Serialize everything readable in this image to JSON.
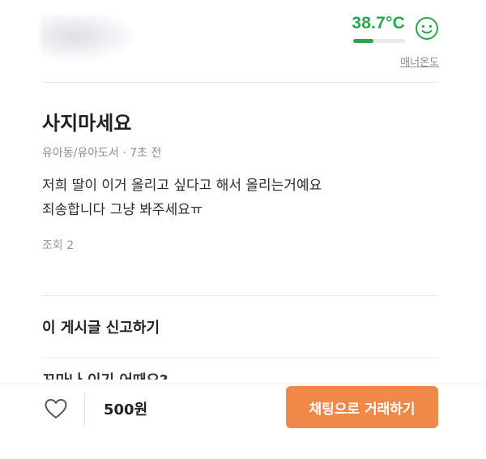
{
  "seller": {
    "manner_temperature": "38.7°C",
    "manner_temperature_level": 0.387,
    "manner_label": "매너온도"
  },
  "post": {
    "title": "사지마세요",
    "meta": "유아동/유아도서 · 7초 전",
    "body_lines": [
      "저희 딸이 이거 올리고 싶다고 해서 올리는거예요",
      "죄송합니다 그냥 봐주세요ㅠ"
    ],
    "views": "조회 2"
  },
  "report_label": "이 게시글 신고하기",
  "next_section_partial": "꼬마나 이기 어때요?",
  "bottom_bar": {
    "price": "500원",
    "chat_button_label": "채팅으로 거래하기"
  },
  "colors": {
    "temperature_green": "#27a84a",
    "accent_orange": "#f0884a"
  },
  "icons": {
    "manner_face": "smiley-face-icon",
    "like": "heart-outline-icon"
  }
}
